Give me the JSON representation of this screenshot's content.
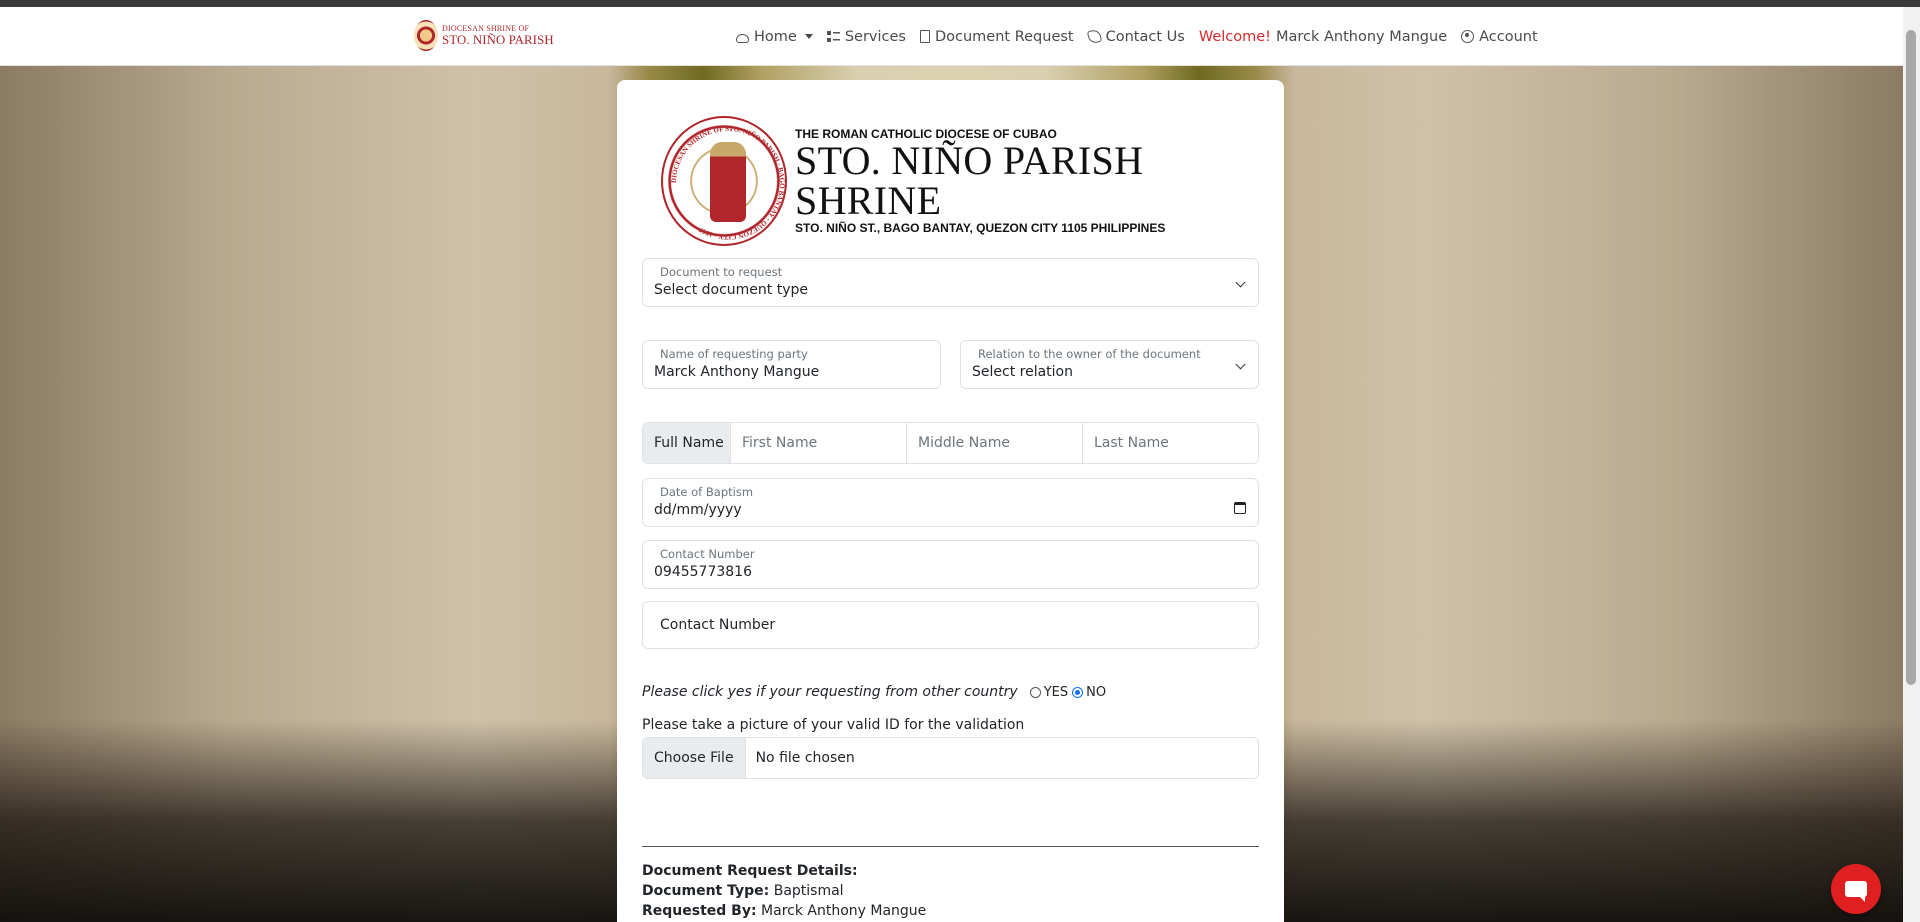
{
  "nav": {
    "brand_top": "DIOCESAN SHRINE OF",
    "brand_bottom": "STO. NIÑO PARISH",
    "home": "Home",
    "services": "Services",
    "document_request": "Document Request",
    "contact_us": "Contact Us",
    "welcome": "Welcome!",
    "user_name": "Marck Anthony Mangue",
    "account": "Account"
  },
  "header": {
    "diocese": "THE ROMAN CATHOLIC DIOCESE OF CUBAO",
    "title": "STO. NIÑO PARISH SHRINE",
    "address": "STO. NIÑO ST., BAGO BANTAY, QUEZON CITY 1105 PHILIPPINES",
    "seal_text": "DIOCESAN SHRINE OF STO. NIÑO PARISH · BAGO BANTAY · QUEZON CITY · 1967"
  },
  "form": {
    "document": {
      "label": "Document to request",
      "value": "Select document type"
    },
    "requesting_party": {
      "label": "Name of requesting party",
      "value": "Marck Anthony Mangue"
    },
    "relation": {
      "label": "Relation to the owner of the document",
      "value": "Select relation"
    },
    "full_name": {
      "addon": "Full Name",
      "first": "First Name",
      "middle": "Middle Name",
      "last": "Last Name"
    },
    "baptism_date": {
      "label": "Date of Baptism",
      "value": "dd/mm/yyyy"
    },
    "contact": {
      "label": "Contact Number",
      "value": "09455773816"
    },
    "contact2": {
      "placeholder": "Contact Number"
    },
    "other_country": {
      "question": "Please click yes if your requesting from other country",
      "yes": "YES",
      "no": "NO",
      "selected": "NO"
    },
    "id_upload": {
      "label": "Please take a picture of your valid ID for the validation",
      "button": "Choose File",
      "status": "No file chosen"
    }
  },
  "details": {
    "heading": "Document Request Details:",
    "doc_type_label": "Document Type:",
    "doc_type_value": "Baptismal",
    "requested_by_label": "Requested By:",
    "requested_by_value": "Marck Anthony Mangue"
  },
  "colors": {
    "accent_red": "#d42a2a",
    "radio_blue": "#0d6efd",
    "chat_red": "#e02020"
  },
  "icons": [
    "cloud-icon",
    "services-icon",
    "document-icon",
    "phone-icon",
    "user-circle-icon",
    "chat-icon"
  ]
}
